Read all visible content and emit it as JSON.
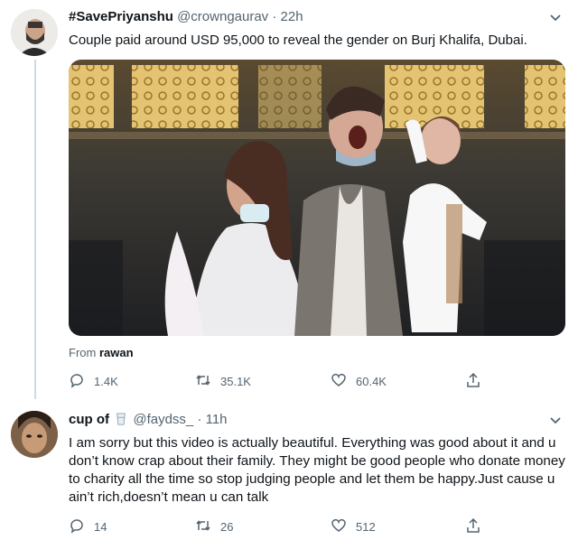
{
  "tweet1": {
    "display_name": "#SavePriyanshu",
    "handle": "@crowngaurav",
    "time": "22h",
    "text": "Couple paid around USD 95,000 to reveal the gender on Burj Khalifa, Dubai.",
    "media_from_label": "From",
    "media_from_user": "rawan",
    "actions": {
      "replies": "1.4K",
      "retweets": "35.1K",
      "likes": "60.4K"
    }
  },
  "tweet2": {
    "display_name": "cup of",
    "handle": "@faydss_",
    "time": "11h",
    "text": "I am sorry but this video is actually beautiful. Everything was good about it and u don’t know crap about their family. They might be good people who donate money to charity all the time so stop judging people and let them be happy.Just cause u ain’t rich,doesn’t mean u can talk",
    "actions": {
      "replies": "14",
      "retweets": "26",
      "likes": "512"
    }
  },
  "separator": "·",
  "icons": {
    "reply": "reply-icon",
    "retweet": "retweet-icon",
    "like": "heart-icon",
    "share": "share-icon",
    "more": "chevron-down-icon",
    "name_emoji": "milk-glass-icon"
  },
  "colors": {
    "text": "#0f1419",
    "secondary": "#536471",
    "thread_line": "#cfd9de"
  }
}
